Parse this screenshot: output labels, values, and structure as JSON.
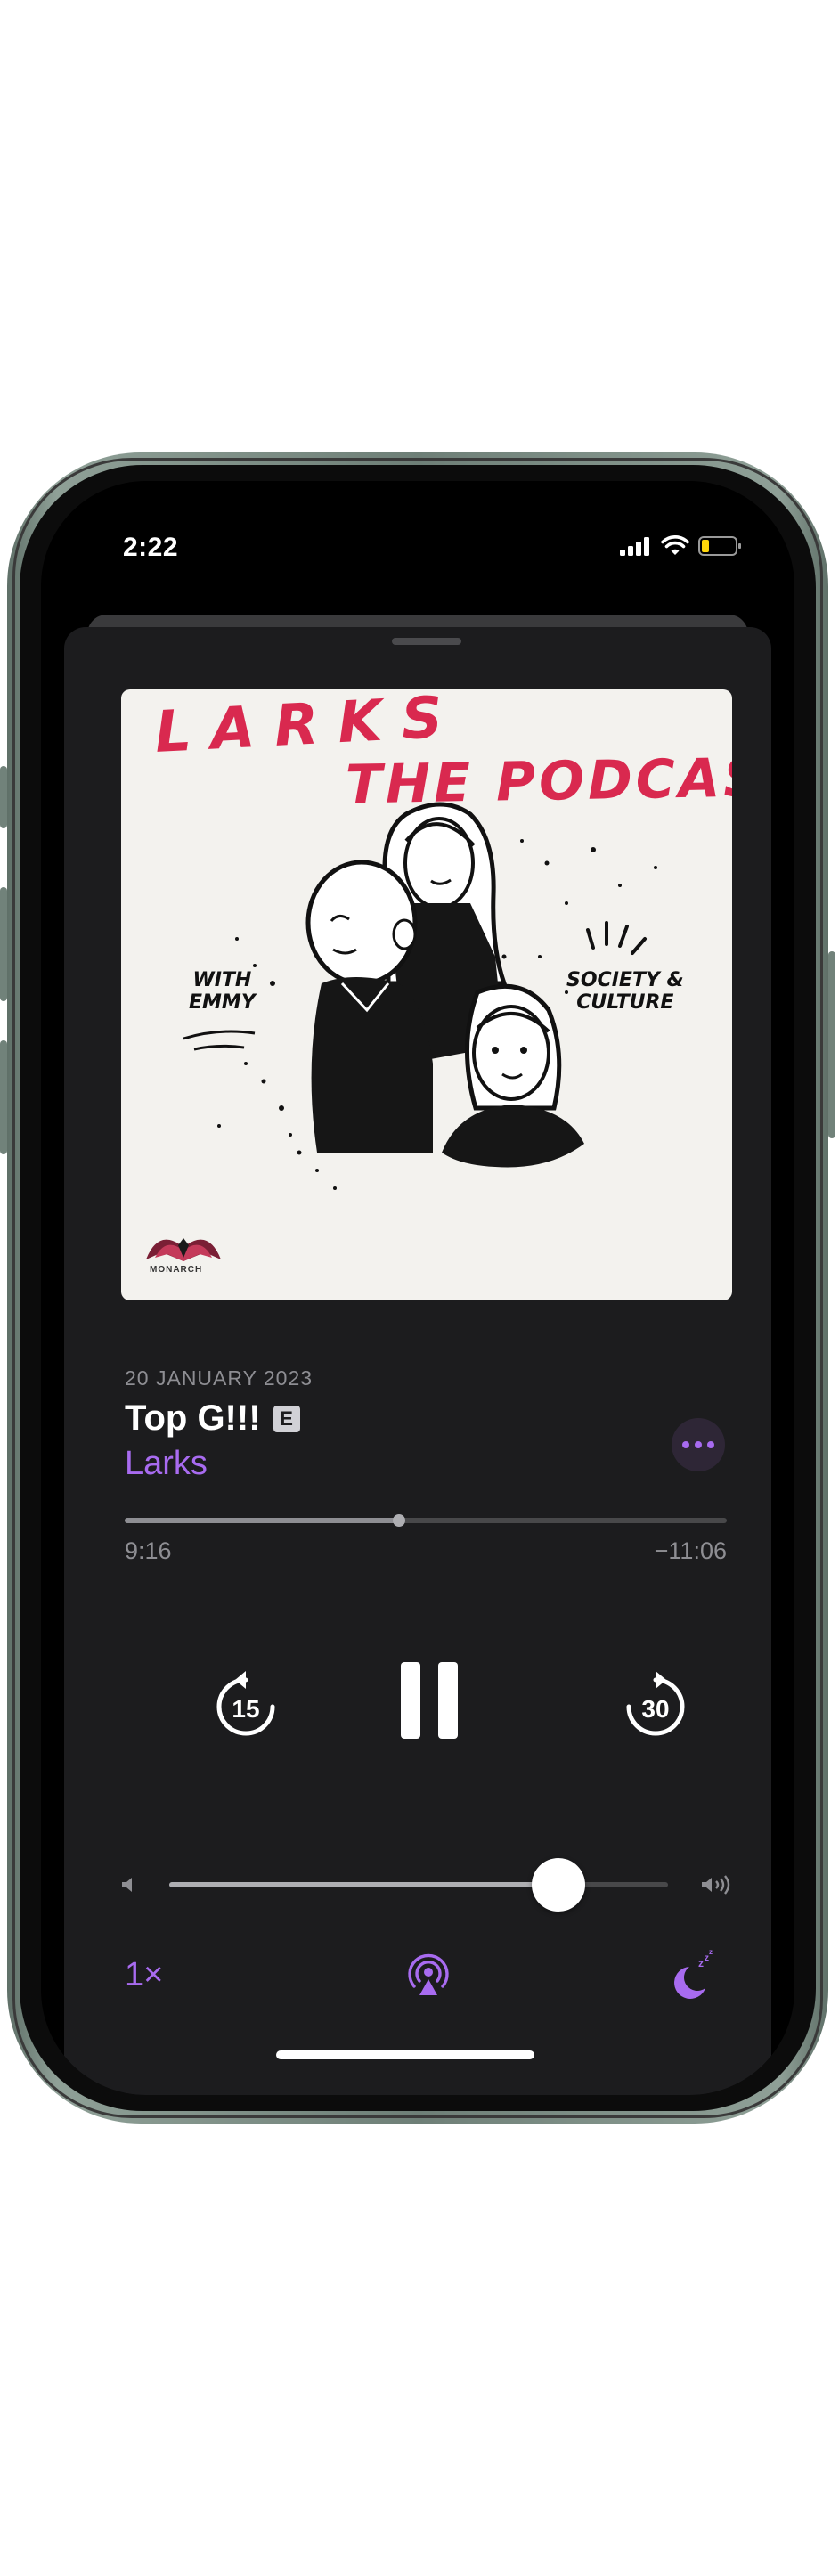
{
  "status_bar": {
    "time": "2:22",
    "battery_level": 0.3,
    "battery_color": "#ffd60a",
    "icons": [
      "signal-icon",
      "wifi-icon",
      "battery-icon"
    ]
  },
  "artwork": {
    "title_line1": "LARKS",
    "title_line2": "THE PODCAST",
    "tag_left_line1": "WITH",
    "tag_left_line2": "EMMY",
    "tag_right_line1": "SOCIETY &",
    "tag_right_line2": "CULTURE",
    "logo_text": "MONARCH",
    "title_color": "#d9294f"
  },
  "episode": {
    "date": "20 JANUARY 2023",
    "title": "Top G!!!",
    "explicit_badge": "E",
    "show": "Larks",
    "accent_color": "#a86bf0"
  },
  "playback": {
    "elapsed": "9:16",
    "remaining": "−11:06",
    "progress": 0.455,
    "skip_back_seconds": "15",
    "skip_forward_seconds": "30",
    "state": "playing"
  },
  "volume": {
    "level": 0.78
  },
  "bottom_controls": {
    "speed": "1×",
    "airplay_icon": "airplay-audio-icon",
    "sleep_icon": "sleep-timer-icon"
  }
}
